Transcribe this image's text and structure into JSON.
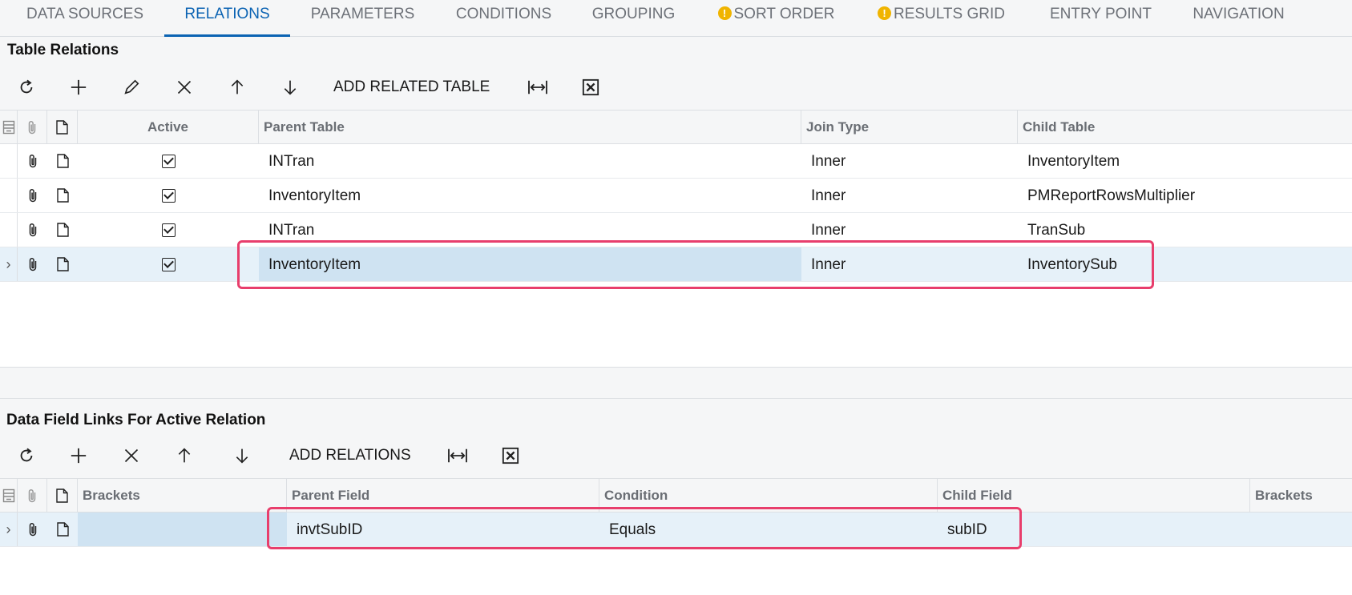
{
  "tabs": [
    {
      "label": "DATA SOURCES",
      "warning": false
    },
    {
      "label": "RELATIONS",
      "warning": false,
      "active": true
    },
    {
      "label": "PARAMETERS",
      "warning": false
    },
    {
      "label": "CONDITIONS",
      "warning": false
    },
    {
      "label": "GROUPING",
      "warning": false
    },
    {
      "label": "SORT ORDER",
      "warning": true
    },
    {
      "label": "RESULTS GRID",
      "warning": true
    },
    {
      "label": "ENTRY POINT",
      "warning": false
    },
    {
      "label": "NAVIGATION",
      "warning": false
    }
  ],
  "relations": {
    "title": "Table Relations",
    "toolbar": {
      "icons": [
        "refresh-icon",
        "add-icon",
        "edit-icon",
        "delete-icon",
        "move-up-icon",
        "move-down-icon",
        "fit-width-icon",
        "export-excel-icon"
      ],
      "add_related_table": "ADD RELATED TABLE"
    },
    "columns": {
      "active": "Active",
      "parent_table": "Parent Table",
      "join_type": "Join Type",
      "child_table": "Child Table"
    },
    "rows": [
      {
        "active": true,
        "parent_table": "INTran",
        "join_type": "Inner",
        "child_table": "InventoryItem"
      },
      {
        "active": true,
        "parent_table": "InventoryItem",
        "join_type": "Inner",
        "child_table": "PMReportRowsMultiplier"
      },
      {
        "active": true,
        "parent_table": "INTran",
        "join_type": "Inner",
        "child_table": "TranSub"
      },
      {
        "active": true,
        "parent_table": "InventoryItem",
        "join_type": "Inner",
        "child_table": "InventorySub",
        "selected": true
      }
    ]
  },
  "field_links": {
    "title": "Data Field Links For Active Relation",
    "toolbar": {
      "icons": [
        "refresh-icon",
        "add-icon",
        "delete-icon",
        "move-up-icon",
        "move-down-icon",
        "fit-width-icon",
        "export-excel-icon"
      ],
      "add_relations": "ADD RELATIONS"
    },
    "columns": {
      "brackets_open": "Brackets",
      "parent_field": "Parent Field",
      "condition": "Condition",
      "child_field": "Child Field",
      "brackets_close": "Brackets"
    },
    "rows": [
      {
        "brackets_open": "",
        "parent_field": "invtSubID",
        "condition": "Equals",
        "child_field": "subID",
        "brackets_close": "",
        "selected": true
      }
    ]
  },
  "colors": {
    "accent": "#0b63b3",
    "highlight": "#e83e6c",
    "selected_row": "#e6f1f9",
    "warning": "#f0b400"
  }
}
